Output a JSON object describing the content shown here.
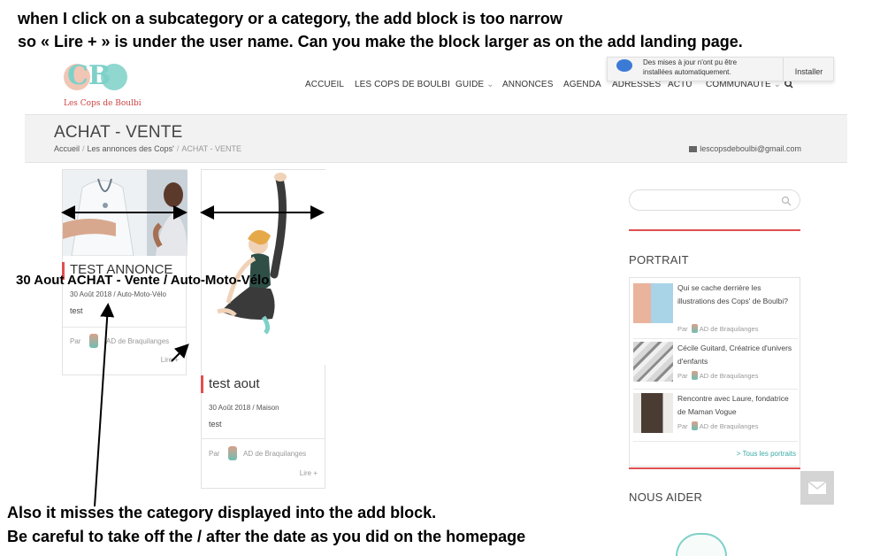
{
  "annotations": {
    "top_line1": "when I click on a subcategory or a category, the add block is too narrow",
    "top_line2": "so « Lire + » is under the user name. Can you make the block  larger as on the add landing page.",
    "middle": "30 Aout  ACHAT - Vente / Auto-Moto-Vélo",
    "bottom_line1": "Also it misses the category displayed into the add block.",
    "bottom_line2": "Be careful to take off the / after the date as you did on the homepage"
  },
  "site": {
    "logo_text": "Les Cops de Boulbi",
    "logo_letters": "CB"
  },
  "nav": {
    "items": [
      "ACCUEIL",
      "LES COPS DE BOULBI",
      "GUIDE",
      "ANNONCES",
      "AGENDA",
      "ADRESSES",
      "ACTU",
      "COMMUNAUTE"
    ],
    "chevron": "⌄"
  },
  "notification": {
    "line1": "Des mises à jour n'ont pu être",
    "line2": "installées automatiquement.",
    "button": "Installer"
  },
  "page": {
    "title": "ACHAT - VENTE",
    "breadcrumb": [
      "Accueil",
      "Les annonces des Cops'",
      "ACHAT - VENTE"
    ],
    "breadcrumb_sep": "/",
    "email": "lescopsdeboulbi@gmail.com"
  },
  "cards": [
    {
      "title": "TEST ANNONCE",
      "meta": "30 Août 2018 / Auto-Moto-Vélo",
      "excerpt": "test",
      "by": "Par",
      "author": "AD de Braquilanges",
      "lire": "Lire +"
    },
    {
      "title": "test aout",
      "meta": "30 Août 2018 / Maison",
      "excerpt": "test",
      "by": "Par",
      "author": "AD de Braquilanges",
      "lire": "Lire +"
    }
  ],
  "sidebar": {
    "portrait_heading": "PORTRAIT",
    "portraits": [
      {
        "title": "Qui se cache derrière les illustrations des Cops' de Boulbi?",
        "by": "Par",
        "author": "AD de Braquilanges"
      },
      {
        "title": "Cécile Guitard, Créatrice d'univers d'enfants",
        "by": "Par",
        "author": "AD de Braquilanges"
      },
      {
        "title": "Rencontre avec Laure, fondatrice de Maman Vogue",
        "by": "Par",
        "author": "AD de Braquilanges"
      }
    ],
    "all_portraits": "> Tous les portraits",
    "help_heading": "NOUS AIDER"
  },
  "colors": {
    "accent_red": "#e05050",
    "teal": "#3aaba5",
    "title_bar": "#f2f2f2"
  }
}
